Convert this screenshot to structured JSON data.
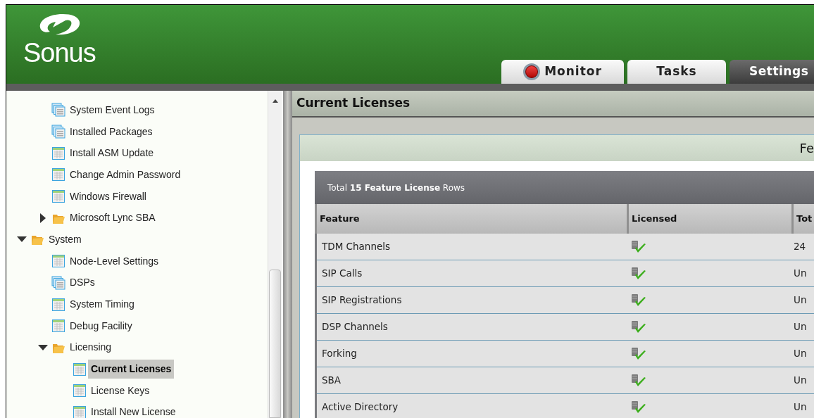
{
  "header": {
    "logo_text": "Sonus"
  },
  "tabs": [
    {
      "label": "Monitor",
      "selected": false,
      "kind": "record"
    },
    {
      "label": "Tasks",
      "selected": false,
      "kind": "plain"
    },
    {
      "label": "Settings",
      "selected": true,
      "kind": "plain"
    }
  ],
  "tree": {
    "continued_children": [
      {
        "label": "System Event Logs",
        "kind": "stack",
        "selected": false
      },
      {
        "label": "Installed Packages",
        "kind": "stack",
        "selected": false
      },
      {
        "label": "Install ASM Update",
        "kind": "table",
        "selected": false
      },
      {
        "label": "Change Admin Password",
        "kind": "table",
        "selected": false
      },
      {
        "label": "Windows Firewall",
        "kind": "table",
        "selected": false
      },
      {
        "label": "Microsoft Lync SBA",
        "kind": "folder",
        "selected": false,
        "expanded": false
      }
    ],
    "items": [
      {
        "label": "System",
        "kind": "folder",
        "selected": false,
        "expanded": true,
        "children": [
          {
            "label": "Node-Level Settings",
            "kind": "table",
            "selected": false
          },
          {
            "label": "DSPs",
            "kind": "stack",
            "selected": false
          },
          {
            "label": "System Timing",
            "kind": "table",
            "selected": false
          },
          {
            "label": "Debug Facility",
            "kind": "table",
            "selected": false
          },
          {
            "label": "Licensing",
            "kind": "folder",
            "selected": false,
            "expanded": true,
            "children": [
              {
                "label": "Current Licenses",
                "kind": "table",
                "selected": true
              },
              {
                "label": "License Keys",
                "kind": "table",
                "selected": false
              },
              {
                "label": "Install New License",
                "kind": "table",
                "selected": false
              }
            ]
          }
        ]
      }
    ]
  },
  "content": {
    "title": "Current Licenses",
    "panel_title": "Fe",
    "table": {
      "summary": "Total **15 Feature License** Rows",
      "columns": [
        "Feature",
        "Licensed",
        "Tot"
      ],
      "rows": [
        {
          "feature": "TDM Channels",
          "licensed": true,
          "total": "24"
        },
        {
          "feature": "SIP Calls",
          "licensed": true,
          "total": "Un"
        },
        {
          "feature": "SIP Registrations",
          "licensed": true,
          "total": "Un"
        },
        {
          "feature": "DSP Channels",
          "licensed": true,
          "total": "Un"
        },
        {
          "feature": "Forking",
          "licensed": true,
          "total": "Un"
        },
        {
          "feature": "SBA",
          "licensed": true,
          "total": "Un"
        },
        {
          "feature": "Active Directory",
          "licensed": true,
          "total": "Un"
        }
      ]
    }
  }
}
